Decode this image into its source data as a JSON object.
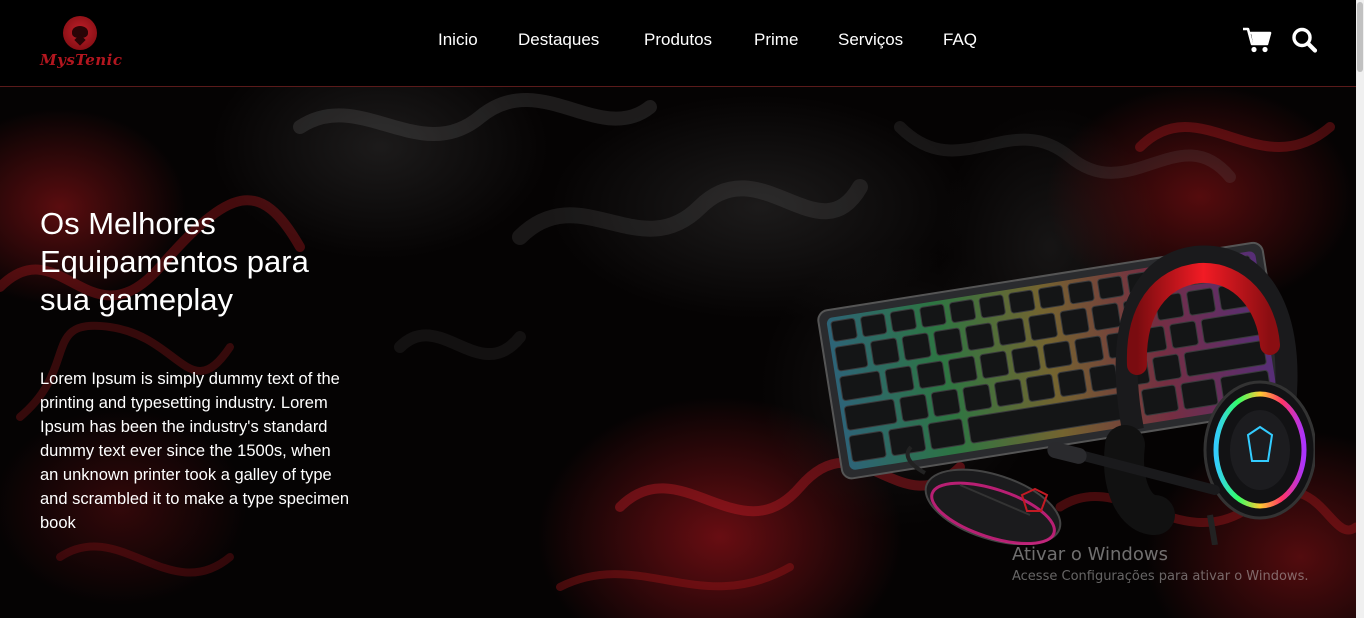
{
  "brand": {
    "logo_text": "MysTenic"
  },
  "nav": {
    "items": [
      {
        "label": "Inicio"
      },
      {
        "label": "Destaques"
      },
      {
        "label": "Produtos"
      },
      {
        "label": "Prime"
      },
      {
        "label": "Serviços"
      },
      {
        "label": "FAQ"
      }
    ]
  },
  "header_icons": {
    "cart": "cart-icon",
    "search": "search-icon"
  },
  "hero": {
    "title": "Os Melhores Equipamentos para sua gameplay",
    "description": "Lorem Ipsum is simply dummy text of the printing and typesetting industry. Lorem Ipsum has been the industry's standard dummy text ever since the 1500s, when an unknown printer took a galley of type and scrambled it to make a type specimen book",
    "image": "keyboard-headset-mouse-product-image"
  },
  "watermark": {
    "title": "Ativar o Windows",
    "subtitle": "Acesse Configurações para ativar o Windows."
  },
  "colors": {
    "accent": "#b3161f",
    "background": "#000000",
    "text": "#ffffff"
  }
}
